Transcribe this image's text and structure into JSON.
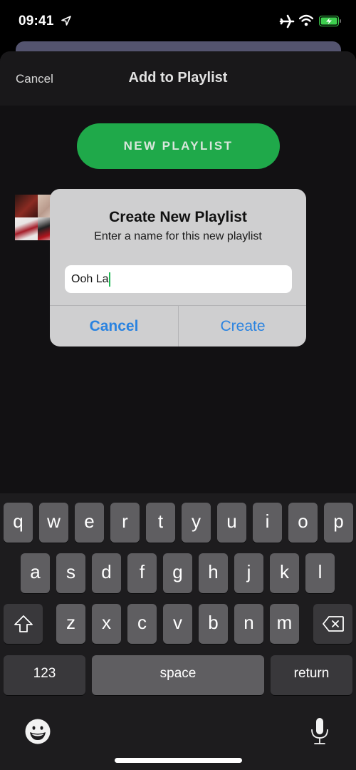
{
  "status_bar": {
    "time": "09:41",
    "icons": [
      "location-arrow-icon",
      "airplane-icon",
      "wifi-icon",
      "battery-charging-icon"
    ],
    "battery_color": "#3ecf4f"
  },
  "header": {
    "cancel_label": "Cancel",
    "title": "Add to Playlist"
  },
  "new_playlist_button": {
    "label": "NEW PLAYLIST",
    "color": "#1fa94a"
  },
  "alert": {
    "title": "Create New Playlist",
    "message": "Enter a name for this new playlist",
    "input_value": "Ooh La",
    "cancel_label": "Cancel",
    "create_label": "Create",
    "button_color": "#2a83e0"
  },
  "keyboard": {
    "row1": [
      "q",
      "w",
      "e",
      "r",
      "t",
      "y",
      "u",
      "i",
      "o",
      "p"
    ],
    "row2": [
      "a",
      "s",
      "d",
      "f",
      "g",
      "h",
      "j",
      "k",
      "l"
    ],
    "row3": [
      "z",
      "x",
      "c",
      "v",
      "b",
      "n",
      "m"
    ],
    "shift_icon": "shift-icon",
    "delete_icon": "backspace-icon",
    "numbers_label": "123",
    "space_label": "space",
    "return_label": "return",
    "emoji_icon": "emoji-icon",
    "mic_icon": "microphone-icon"
  }
}
